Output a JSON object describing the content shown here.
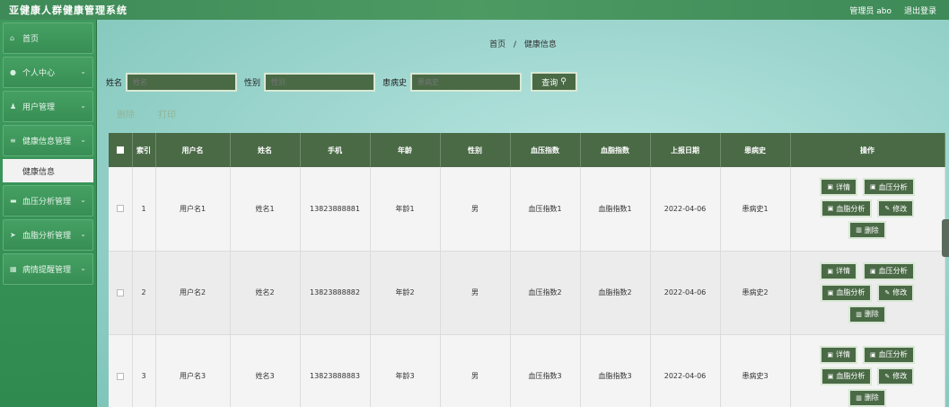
{
  "app": {
    "title": "亚健康人群健康管理系统",
    "user_label": "管理员 abo",
    "logout": "退出登录"
  },
  "sidebar": {
    "items": [
      {
        "icon": "home-icon",
        "label": "首页",
        "chevron": false
      },
      {
        "icon": "user-icon",
        "label": "个人中心",
        "chevron": true
      },
      {
        "icon": "users-icon",
        "label": "用户管理",
        "chevron": true
      },
      {
        "icon": "list-icon",
        "label": "健康信息管理",
        "chevron": true
      }
    ],
    "submenu": "健康信息",
    "items2": [
      {
        "icon": "chart-icon",
        "label": "血压分析管理",
        "chevron": true
      },
      {
        "icon": "send-icon",
        "label": "血脂分析管理",
        "chevron": true
      },
      {
        "icon": "grid-icon",
        "label": "病情提醒管理",
        "chevron": true
      }
    ]
  },
  "breadcrumb": {
    "home": "首页",
    "sep": "/",
    "current": "健康信息"
  },
  "search": {
    "name_label": "姓名",
    "name_placeholder": "姓名",
    "gender_label": "性别",
    "gender_placeholder": "性别",
    "history_label": "患病史",
    "history_placeholder": "患病史",
    "query_button": "查询"
  },
  "actions": {
    "delete": "删除",
    "print": "打印"
  },
  "table": {
    "headers": [
      "索引",
      "用户名",
      "姓名",
      "手机",
      "年龄",
      "性别",
      "血压指数",
      "血脂指数",
      "上报日期",
      "患病史",
      "操作"
    ],
    "rows": [
      {
        "index": "1",
        "username": "用户名1",
        "name": "姓名1",
        "phone": "13823888881",
        "age": "年龄1",
        "gender": "男",
        "bp": "血压指数1",
        "lipid": "血脂指数1",
        "date": "2022-04-06",
        "history": "患病史1"
      },
      {
        "index": "2",
        "username": "用户名2",
        "name": "姓名2",
        "phone": "13823888882",
        "age": "年龄2",
        "gender": "男",
        "bp": "血压指数2",
        "lipid": "血脂指数2",
        "date": "2022-04-06",
        "history": "患病史2"
      },
      {
        "index": "3",
        "username": "用户名3",
        "name": "姓名3",
        "phone": "13823888883",
        "age": "年龄3",
        "gender": "男",
        "bp": "血压指数3",
        "lipid": "血脂指数3",
        "date": "2022-04-06",
        "history": "患病史3"
      }
    ],
    "ops": {
      "detail": "详情",
      "bp_analysis": "血压分析",
      "lipid_analysis": "血脂分析",
      "edit": "修改",
      "delete": "删除"
    }
  },
  "colors": {
    "topbar": "#3e8a58",
    "sidebar": "#3f9a5d",
    "button": "#4a6a46",
    "table_header": "#4a6a46"
  }
}
